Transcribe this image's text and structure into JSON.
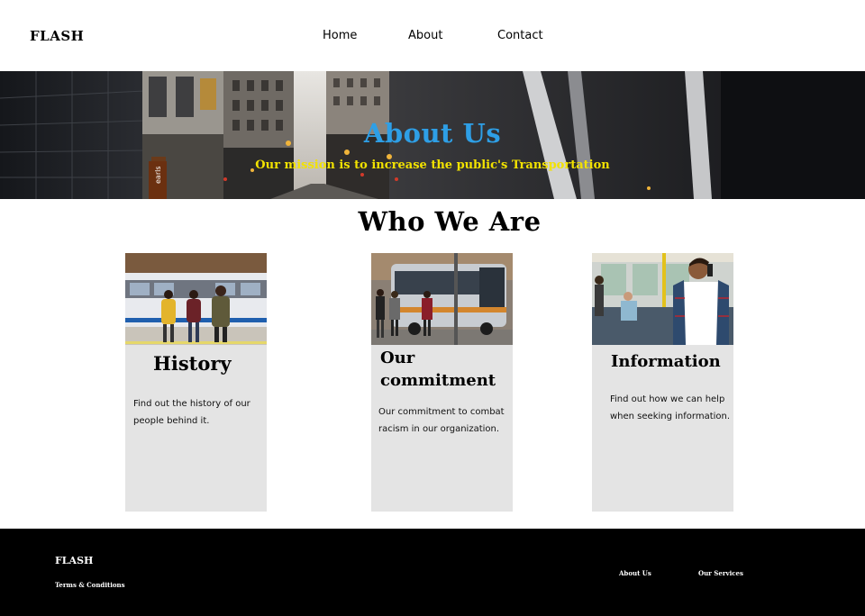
{
  "header": {
    "logo": "FLASH",
    "nav": {
      "home": "Home",
      "about": "About",
      "contact": "Contact"
    }
  },
  "hero": {
    "title": "About Us",
    "subtitle": "Our mission is to increase the public's Transportation",
    "sign_text": "earls"
  },
  "section": {
    "title": "Who We Are"
  },
  "cards": [
    {
      "title": "History",
      "text_line1": "Find out the history of our",
      "text_line2": "people behind it."
    },
    {
      "title_line1": "Our",
      "title_line2": "commitment",
      "text_line1": "Our commitment to combat",
      "text_line2": "racism in our organization."
    },
    {
      "title": "Information",
      "text_line1": "Find out how we can help",
      "text_line2": "when seeking information."
    }
  ],
  "footer": {
    "logo": "FLASH",
    "terms": "Terms & Conditions",
    "about": "About Us",
    "services": "Our Services"
  },
  "colors": {
    "hero_title": "#2e9fe6",
    "hero_subtitle": "#f2e200",
    "card_bg": "#e4e4e4",
    "footer_bg": "#000000"
  }
}
